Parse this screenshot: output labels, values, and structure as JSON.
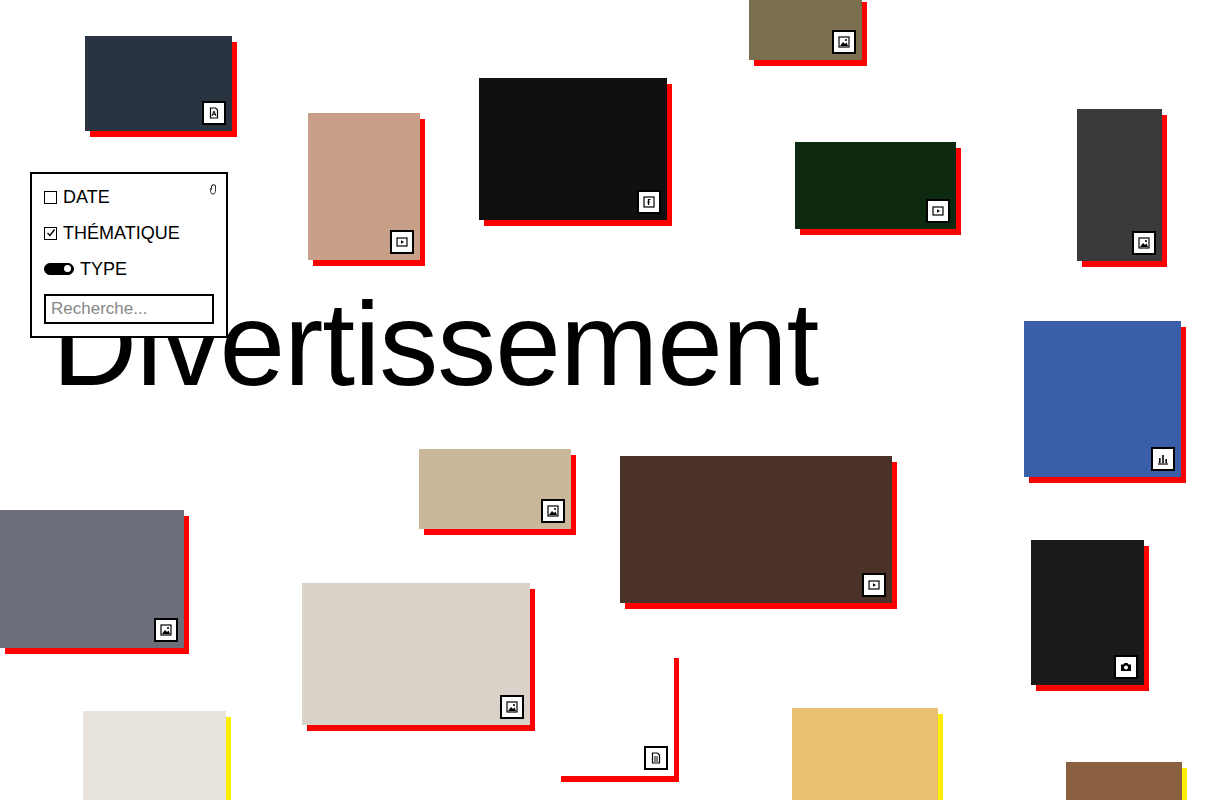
{
  "heading": "Divertissement",
  "filters": [
    {
      "label": "DATE",
      "kind": "checkbox",
      "checked": false
    },
    {
      "label": "THÉMATIQUE",
      "kind": "checkbox",
      "checked": true
    },
    {
      "label": "TYPE",
      "kind": "toggle",
      "on": true
    }
  ],
  "search": {
    "placeholder": "Recherche..."
  },
  "tiles": [
    {
      "kind": "pdf",
      "color": "#ff0000"
    },
    {
      "kind": "image",
      "color": "#ff0000"
    },
    {
      "kind": "video",
      "color": "#ff0000"
    },
    {
      "kind": "gif",
      "color": "#ff0000"
    },
    {
      "kind": "video",
      "color": "#ff0000"
    },
    {
      "kind": "image",
      "color": "#ff0000"
    },
    {
      "kind": "chart",
      "color": "#ff0000"
    },
    {
      "kind": "image",
      "color": "#ff0000"
    },
    {
      "kind": "video",
      "color": "#ff0000"
    },
    {
      "kind": "image",
      "color": "#ff0000"
    },
    {
      "kind": "camera",
      "color": "#ff0000"
    },
    {
      "kind": "image",
      "color": "#ff0000"
    },
    {
      "kind": "doc",
      "color": "#ff0000"
    },
    {
      "kind": "none",
      "color": "#ffee00"
    },
    {
      "kind": "none",
      "color": "#ffee00"
    },
    {
      "kind": "none",
      "color": "#ffee00"
    }
  ]
}
